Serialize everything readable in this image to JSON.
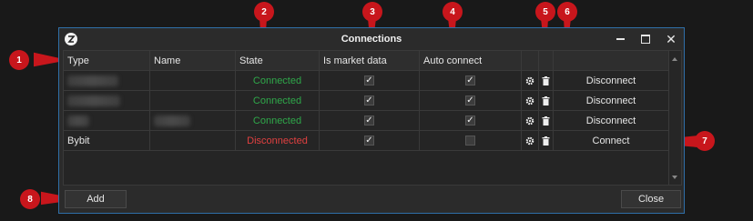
{
  "window": {
    "title": "Connections"
  },
  "grid": {
    "columns": [
      "Type",
      "Name",
      "State",
      "Is market data",
      "Auto connect"
    ],
    "rows": [
      {
        "type": "",
        "name": "",
        "state": "Connected",
        "market_data": true,
        "auto_connect": true,
        "action": "Disconnect"
      },
      {
        "type": "",
        "name": "",
        "state": "Connected",
        "market_data": true,
        "auto_connect": true,
        "action": "Disconnect"
      },
      {
        "type": "",
        "name": "",
        "state": "Connected",
        "market_data": true,
        "auto_connect": true,
        "action": "Disconnect"
      },
      {
        "type": "Bybit",
        "name": "",
        "state": "Disconnected",
        "market_data": true,
        "auto_connect": false,
        "action": "Connect"
      }
    ]
  },
  "buttons": {
    "add": "Add",
    "close": "Close"
  },
  "callouts": [
    "1",
    "2",
    "3",
    "4",
    "5",
    "6",
    "7",
    "8"
  ],
  "icons": {
    "logo": "app-logo-icon",
    "settings": "gear-icon",
    "delete": "trash-icon",
    "minimize": "minimize-icon",
    "maximize": "maximize-icon",
    "close": "close-icon"
  },
  "colors": {
    "connected": "#2fa84a",
    "disconnected": "#e04040",
    "callout": "#c8161c",
    "window_border": "#2f6fa8"
  }
}
